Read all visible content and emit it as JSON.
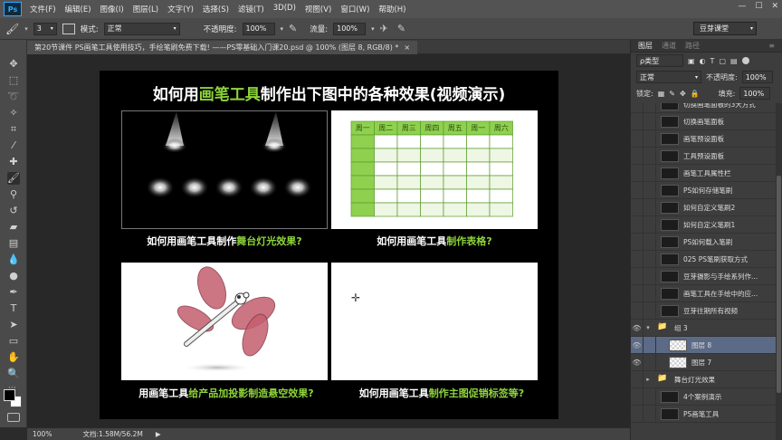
{
  "menubar": {
    "logo": "Ps",
    "items": [
      "文件(F)",
      "编辑(E)",
      "图像(I)",
      "图层(L)",
      "文字(Y)",
      "选择(S)",
      "滤镜(T)",
      "3D(D)",
      "视图(V)",
      "窗口(W)",
      "帮助(H)"
    ]
  },
  "options": {
    "brush_size": "3",
    "mode_label": "模式:",
    "mode_value": "正常",
    "opacity_label": "不透明度:",
    "opacity_value": "100%",
    "flow_label": "流量:",
    "flow_value": "100%",
    "workspace": "豆芽课堂"
  },
  "doc_tab": {
    "label": "第20节课件 PS画笔工具使用技巧，手绘笔刷免费下载! ——PS零基础入门课20.psd @ 100% (图层 8, RGB/8) *"
  },
  "document": {
    "title_pre": "如何用",
    "title_hl": "画笔工具",
    "title_post": "制作出下图中的各种效果(视频演示)",
    "captions": [
      {
        "pre": "如何用画笔工具制作",
        "hl": "舞台灯光效果?"
      },
      {
        "pre": "如何用画笔工具",
        "hl": "制作表格?"
      },
      {
        "pre": "用画笔工具",
        "hl": "给产品加投影制造悬空效果?"
      },
      {
        "pre": "如何用画笔工具",
        "hl": "制作主图促销标签等?"
      }
    ],
    "table_headers": [
      "周一",
      "周二",
      "周三",
      "周四",
      "周五",
      "周一",
      "周六"
    ]
  },
  "status": {
    "zoom": "100%",
    "doc_info": "文档:1.58M/56.2M"
  },
  "layers_panel": {
    "tabs": [
      "图层",
      "通道",
      "路径"
    ],
    "filter_label": "ρ类型",
    "blend_mode": "正常",
    "opacity_label": "不透明度:",
    "opacity_value": "100%",
    "lock_label": "锁定:",
    "fill_label": "填充:",
    "fill_value": "100%",
    "layers": [
      {
        "name": "切换画笔面板的3大方式",
        "type": "layer",
        "visible": false,
        "thumb": "dark"
      },
      {
        "name": "切换画笔面板",
        "type": "layer",
        "visible": false,
        "thumb": "dark"
      },
      {
        "name": "画笔预设面板",
        "type": "layer",
        "visible": false,
        "thumb": "dark"
      },
      {
        "name": "工具预设面板",
        "type": "layer",
        "visible": false,
        "thumb": "dark"
      },
      {
        "name": "画笔工具属性栏",
        "type": "layer",
        "visible": false,
        "thumb": "dark"
      },
      {
        "name": "PS如何存储笔刷",
        "type": "layer",
        "visible": false,
        "thumb": "dark"
      },
      {
        "name": "如何自定义笔刷2",
        "type": "layer",
        "visible": false,
        "thumb": "dark"
      },
      {
        "name": "如何自定义笔刷1",
        "type": "layer",
        "visible": false,
        "thumb": "dark"
      },
      {
        "name": "PS如何载入笔刷",
        "type": "layer",
        "visible": false,
        "thumb": "dark"
      },
      {
        "name": "025 PS笔刷获取方式",
        "type": "layer",
        "visible": false,
        "thumb": "dark"
      },
      {
        "name": "豆芽摄影与手绘系列作...",
        "type": "layer",
        "visible": false,
        "thumb": "dark"
      },
      {
        "name": "画笔工具在手绘中的应...",
        "type": "layer",
        "visible": false,
        "thumb": "dark"
      },
      {
        "name": "豆芽往期所有视频",
        "type": "layer",
        "visible": false,
        "thumb": "dark"
      },
      {
        "name": "组 3",
        "type": "group-open",
        "visible": true,
        "thumb": "folder"
      },
      {
        "name": "图层 8",
        "type": "layer",
        "visible": true,
        "thumb": "check",
        "selected": true
      },
      {
        "name": "图层 7",
        "type": "layer",
        "visible": true,
        "thumb": "check"
      },
      {
        "name": "舞台灯光效果",
        "type": "group",
        "visible": false,
        "thumb": "folder"
      },
      {
        "name": "4个案例演示",
        "type": "layer",
        "visible": false,
        "thumb": "dark"
      },
      {
        "name": "PS画笔工具",
        "type": "layer",
        "visible": false,
        "thumb": "dark"
      }
    ]
  },
  "colors": {
    "accent_green": "#8dd43a",
    "table_header": "#8fd14f",
    "selected_layer": "#5b6a86",
    "dragonfly_wing": "#c45e6e"
  }
}
